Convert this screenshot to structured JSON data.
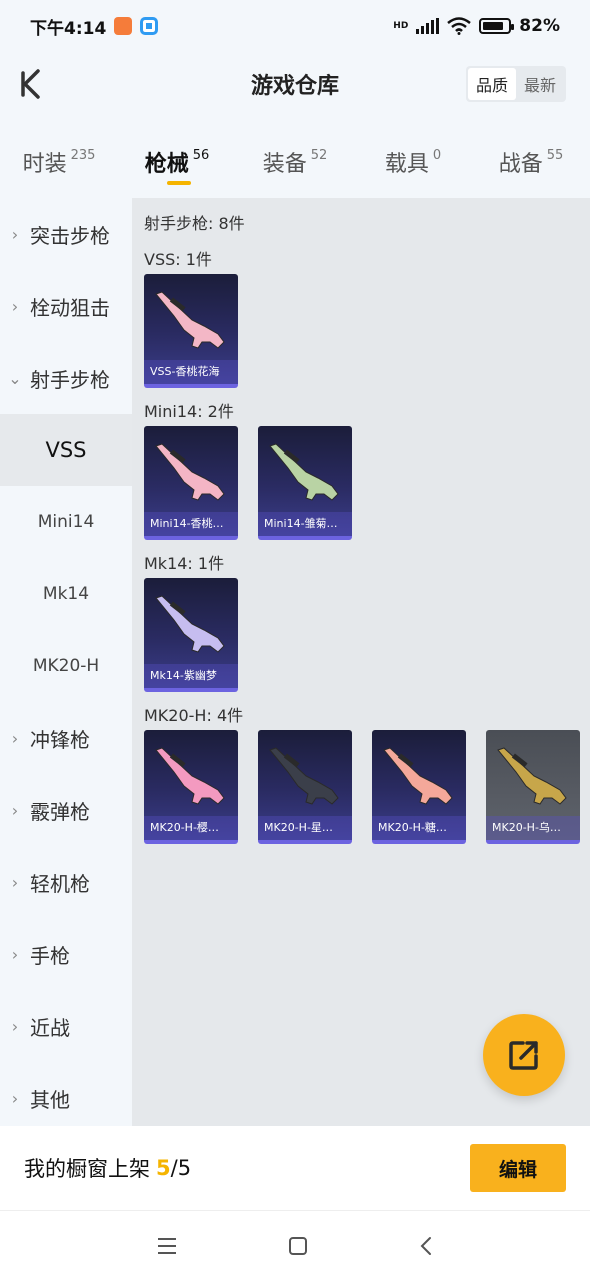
{
  "status": {
    "time": "下午4:14",
    "network": "HD",
    "battery": "82%",
    "battery_level": 0.82
  },
  "header": {
    "title": "游戏仓库",
    "sort": [
      "品质",
      "最新"
    ],
    "sort_active": 0
  },
  "tabs": [
    {
      "label": "时装",
      "count": "235"
    },
    {
      "label": "枪械",
      "count": "56",
      "active": true
    },
    {
      "label": "装备",
      "count": "52"
    },
    {
      "label": "载具",
      "count": "0"
    },
    {
      "label": "战备",
      "count": "55"
    }
  ],
  "sidebar": {
    "items": [
      {
        "label": "突击步枪",
        "chevron": "›"
      },
      {
        "label": "栓动狙击",
        "chevron": "›"
      },
      {
        "label": "射手步枪",
        "chevron": "⌄"
      },
      {
        "label": "VSS"
      },
      {
        "label": "Mini14"
      },
      {
        "label": "Mk14"
      },
      {
        "label": "MK20-H"
      },
      {
        "label": "冲锋枪",
        "chevron": "›"
      },
      {
        "label": "霰弹枪",
        "chevron": "›"
      },
      {
        "label": "轻机枪",
        "chevron": "›"
      },
      {
        "label": "手枪",
        "chevron": "›"
      },
      {
        "label": "近战",
        "chevron": "›"
      },
      {
        "label": "其他",
        "chevron": "›"
      }
    ]
  },
  "content": {
    "section_title": "射手步枪: 8件",
    "groups": [
      {
        "title": "VSS: 1件",
        "items": [
          {
            "name": "VSS-香桃花海",
            "color": "#f3b7c6"
          }
        ]
      },
      {
        "title": "Mini14: 2件",
        "items": [
          {
            "name": "Mini14-香桃…",
            "color": "#f4b5c5"
          },
          {
            "name": "Mini14-雏菊…",
            "color": "#b9d3a4"
          }
        ]
      },
      {
        "title": "Mk14: 1件",
        "items": [
          {
            "name": "Mk14-紫幽梦",
            "color": "#c6bdf0"
          }
        ]
      },
      {
        "title": "MK20-H: 4件",
        "items": [
          {
            "name": "MK20-H-樱…",
            "color": "#f39ac0"
          },
          {
            "name": "MK20-H-星…",
            "color": "#3b3f4a"
          },
          {
            "name": "MK20-H-糖…",
            "color": "#f4a89a"
          },
          {
            "name": "MK20-H-乌…",
            "color": "#c7a64a",
            "grey": true
          }
        ]
      }
    ]
  },
  "bottom": {
    "label": "我的橱窗上架",
    "count_current": "5",
    "count_total": "/5",
    "edit": "编辑"
  },
  "icons": {
    "back": "back-icon",
    "fab": "share-edit-icon",
    "nav": [
      "menu-icon",
      "home-icon",
      "back-nav-icon"
    ]
  }
}
